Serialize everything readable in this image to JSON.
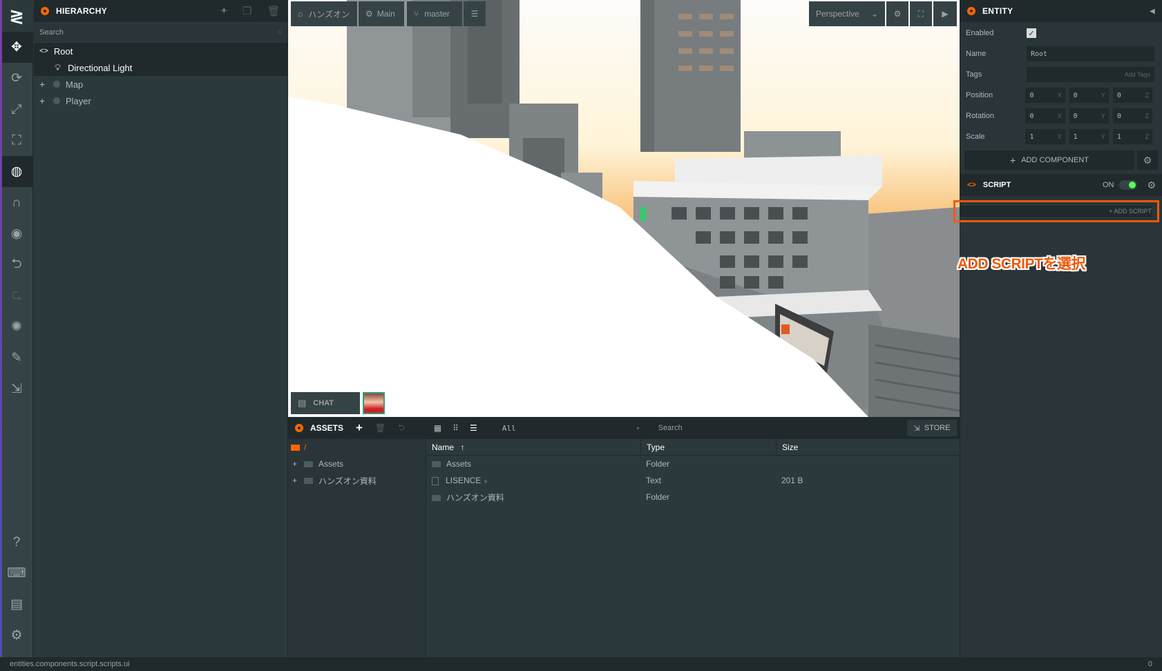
{
  "hierarchy": {
    "title": "HIERARCHY",
    "search_placeholder": "Search",
    "items": [
      {
        "label": "Root"
      },
      {
        "label": "Directional Light"
      },
      {
        "label": "Map"
      },
      {
        "label": "Player"
      }
    ]
  },
  "viewport": {
    "breadcrumb_project": "ハンズオン",
    "scene": "Main",
    "branch": "master",
    "camera": "Perspective",
    "chat_label": "CHAT"
  },
  "assets": {
    "title": "ASSETS",
    "filter": "All",
    "search_placeholder": "Search",
    "store_label": "STORE",
    "tree_root": "/",
    "tree": [
      {
        "label": "Assets"
      },
      {
        "label": "ハンズオン資料"
      }
    ],
    "columns": {
      "name": "Name",
      "type": "Type",
      "size": "Size"
    },
    "rows": [
      {
        "name": "Assets",
        "type": "Folder",
        "size": ""
      },
      {
        "name": "LISENCE",
        "type": "Text",
        "size": "201 B"
      },
      {
        "name": "ハンズオン資料",
        "type": "Folder",
        "size": ""
      }
    ]
  },
  "inspector": {
    "title": "ENTITY",
    "enabled_label": "Enabled",
    "name_label": "Name",
    "name_value": "Root",
    "tags_label": "Tags",
    "tags_placeholder": "Add Tags",
    "position_label": "Position",
    "rotation_label": "Rotation",
    "scale_label": "Scale",
    "position": [
      "0",
      "0",
      "0"
    ],
    "rotation": [
      "0",
      "0",
      "0"
    ],
    "scale": [
      "1",
      "1",
      "1"
    ],
    "axes": [
      "X",
      "Y",
      "Z"
    ],
    "add_component": "ADD COMPONENT",
    "script_title": "SCRIPT",
    "script_state": "ON",
    "add_script": "+ ADD SCRIPT"
  },
  "annotation": "ADD SCRIPTを選択",
  "status": {
    "path": "entities.components.script.scripts.ui",
    "right": "0"
  },
  "colors": {
    "accent": "#ff6600",
    "highlight": "#ee5a0c",
    "panel": "#2c393c",
    "panel_dark": "#20292b",
    "toggle_on": "#55ff55"
  }
}
